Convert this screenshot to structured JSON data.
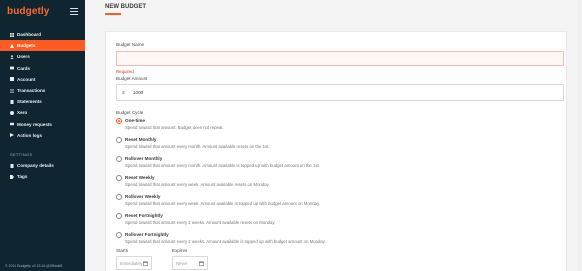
{
  "brand": {
    "logo_text": "budgetly",
    "menu_icon": "hamburger-icon",
    "accent": "#ff5a1f",
    "sidebar_bg": "#0f2530"
  },
  "sidebar": {
    "items": [
      {
        "label": "Dashboard",
        "icon": "dashboard-icon",
        "active": false
      },
      {
        "label": "Budgets",
        "icon": "budgets-icon",
        "active": true
      },
      {
        "label": "Users",
        "icon": "users-icon",
        "active": false
      },
      {
        "label": "Cards",
        "icon": "card-icon",
        "active": false
      },
      {
        "label": "Account",
        "icon": "account-icon",
        "active": false
      },
      {
        "label": "Transactions",
        "icon": "transactions-icon",
        "active": false
      },
      {
        "label": "Statements",
        "icon": "statements-icon",
        "active": false
      },
      {
        "label": "Xero",
        "icon": "xero-icon",
        "active": false
      },
      {
        "label": "Money requests",
        "icon": "money-requests-icon",
        "active": false
      },
      {
        "label": "Action logs",
        "icon": "action-logs-icon",
        "active": false
      }
    ],
    "settings_title": "SETTINGS",
    "settings_items": [
      {
        "label": "Company details",
        "icon": "company-icon"
      },
      {
        "label": "Tags",
        "icon": "tag-icon"
      }
    ],
    "footer": "© 2021 Budgetly v2.13.16 @0f5cdd5"
  },
  "page": {
    "title": "NEW BUDGET"
  },
  "form": {
    "name_label": "Budget Name",
    "name_value": "",
    "name_error": "Required",
    "amount_label": "Budget Amount",
    "currency_symbol": "$",
    "amount_value": "1000",
    "cycle_label": "Budget Cycle",
    "cycle_options": [
      {
        "title": "One-time",
        "description": "Spend toward that amount. Budget does not repeat.",
        "selected": true
      },
      {
        "title": "Reset Monthly",
        "description": "Spend toward that amount every month. Amount available resets on the 1st.",
        "selected": false
      },
      {
        "title": "Rollover Monthly",
        "description": "Spend toward that amount every month. Amount available is topped up with budget amount on the 1st.",
        "selected": false
      },
      {
        "title": "Reset Weekly",
        "description": "Spend toward that amount every week. Amount available resets on Monday.",
        "selected": false
      },
      {
        "title": "Rollover Weekly",
        "description": "Spend toward that amount every week. Amount available is topped up with budget amount on Monday.",
        "selected": false
      },
      {
        "title": "Reset Fortnightly",
        "description": "Spend toward that amount every 2 weeks. Amount available resets on Monday.",
        "selected": false
      },
      {
        "title": "Rollover Fortnightly",
        "description": "Spend toward that amount every 2 weeks. Amount available is topped up with budget amount on Monday.",
        "selected": false
      }
    ],
    "starts_label": "Starts",
    "starts_placeholder": "Immediately",
    "expires_label": "Expires",
    "expires_placeholder": "Never"
  }
}
